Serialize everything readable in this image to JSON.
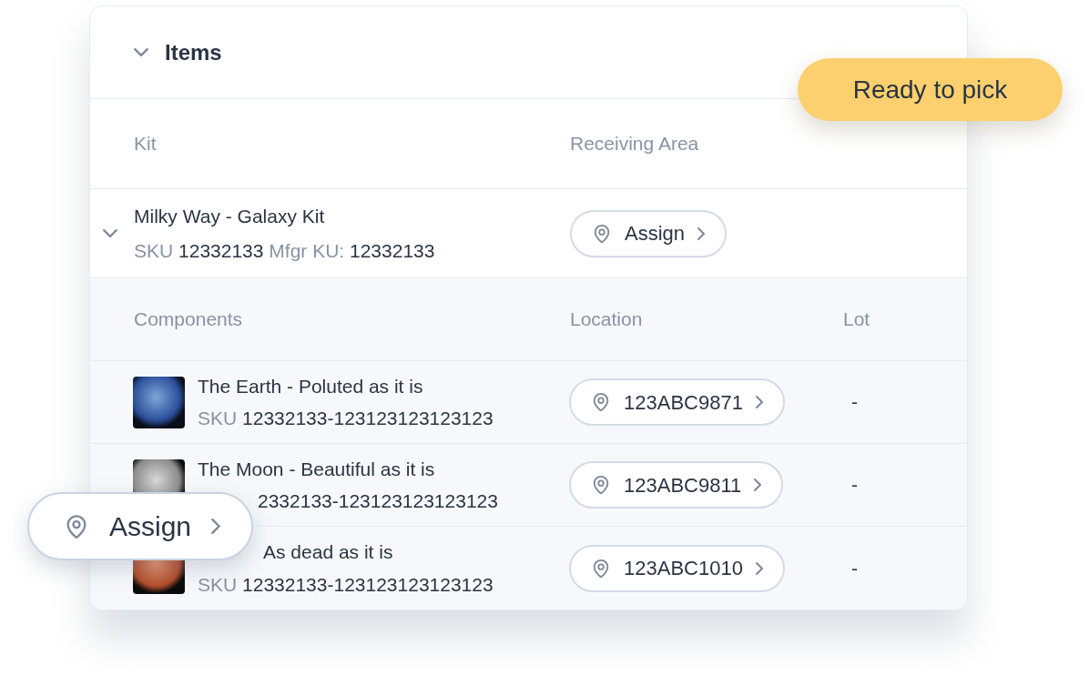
{
  "section": {
    "title": "Items",
    "expanded": true
  },
  "status_badge": "Ready to pick",
  "kit_columns": [
    "Kit",
    "Receiving Area"
  ],
  "kit": {
    "name": "Milky Way - Galaxy Kit",
    "sku_label": "SKU",
    "sku": "12332133",
    "mfgr_label": "Mfgr KU:",
    "mfgr": "12332133",
    "expanded": true,
    "receiving_area": "Assign"
  },
  "component_columns": [
    "Components",
    "Location",
    "Lot"
  ],
  "components": [
    {
      "kind": "plain",
      "name": "The Earth - Poluted as it is",
      "sku_label": "SKU",
      "sku": "12332133-123123123123123",
      "location": "123ABC9871",
      "lot": "-"
    },
    {
      "kind": "sku-covered",
      "name": "The Moon - Beautiful as it is",
      "sku": "2332133-123123123123123",
      "location": "123ABC9811",
      "lot": "-"
    },
    {
      "kind": "name-covered",
      "name": "As dead as it is",
      "sku_label": "SKU",
      "sku": "12332133-123123123123123",
      "location": "123ABC1010",
      "lot": "-"
    }
  ],
  "floating_button": "Assign"
}
